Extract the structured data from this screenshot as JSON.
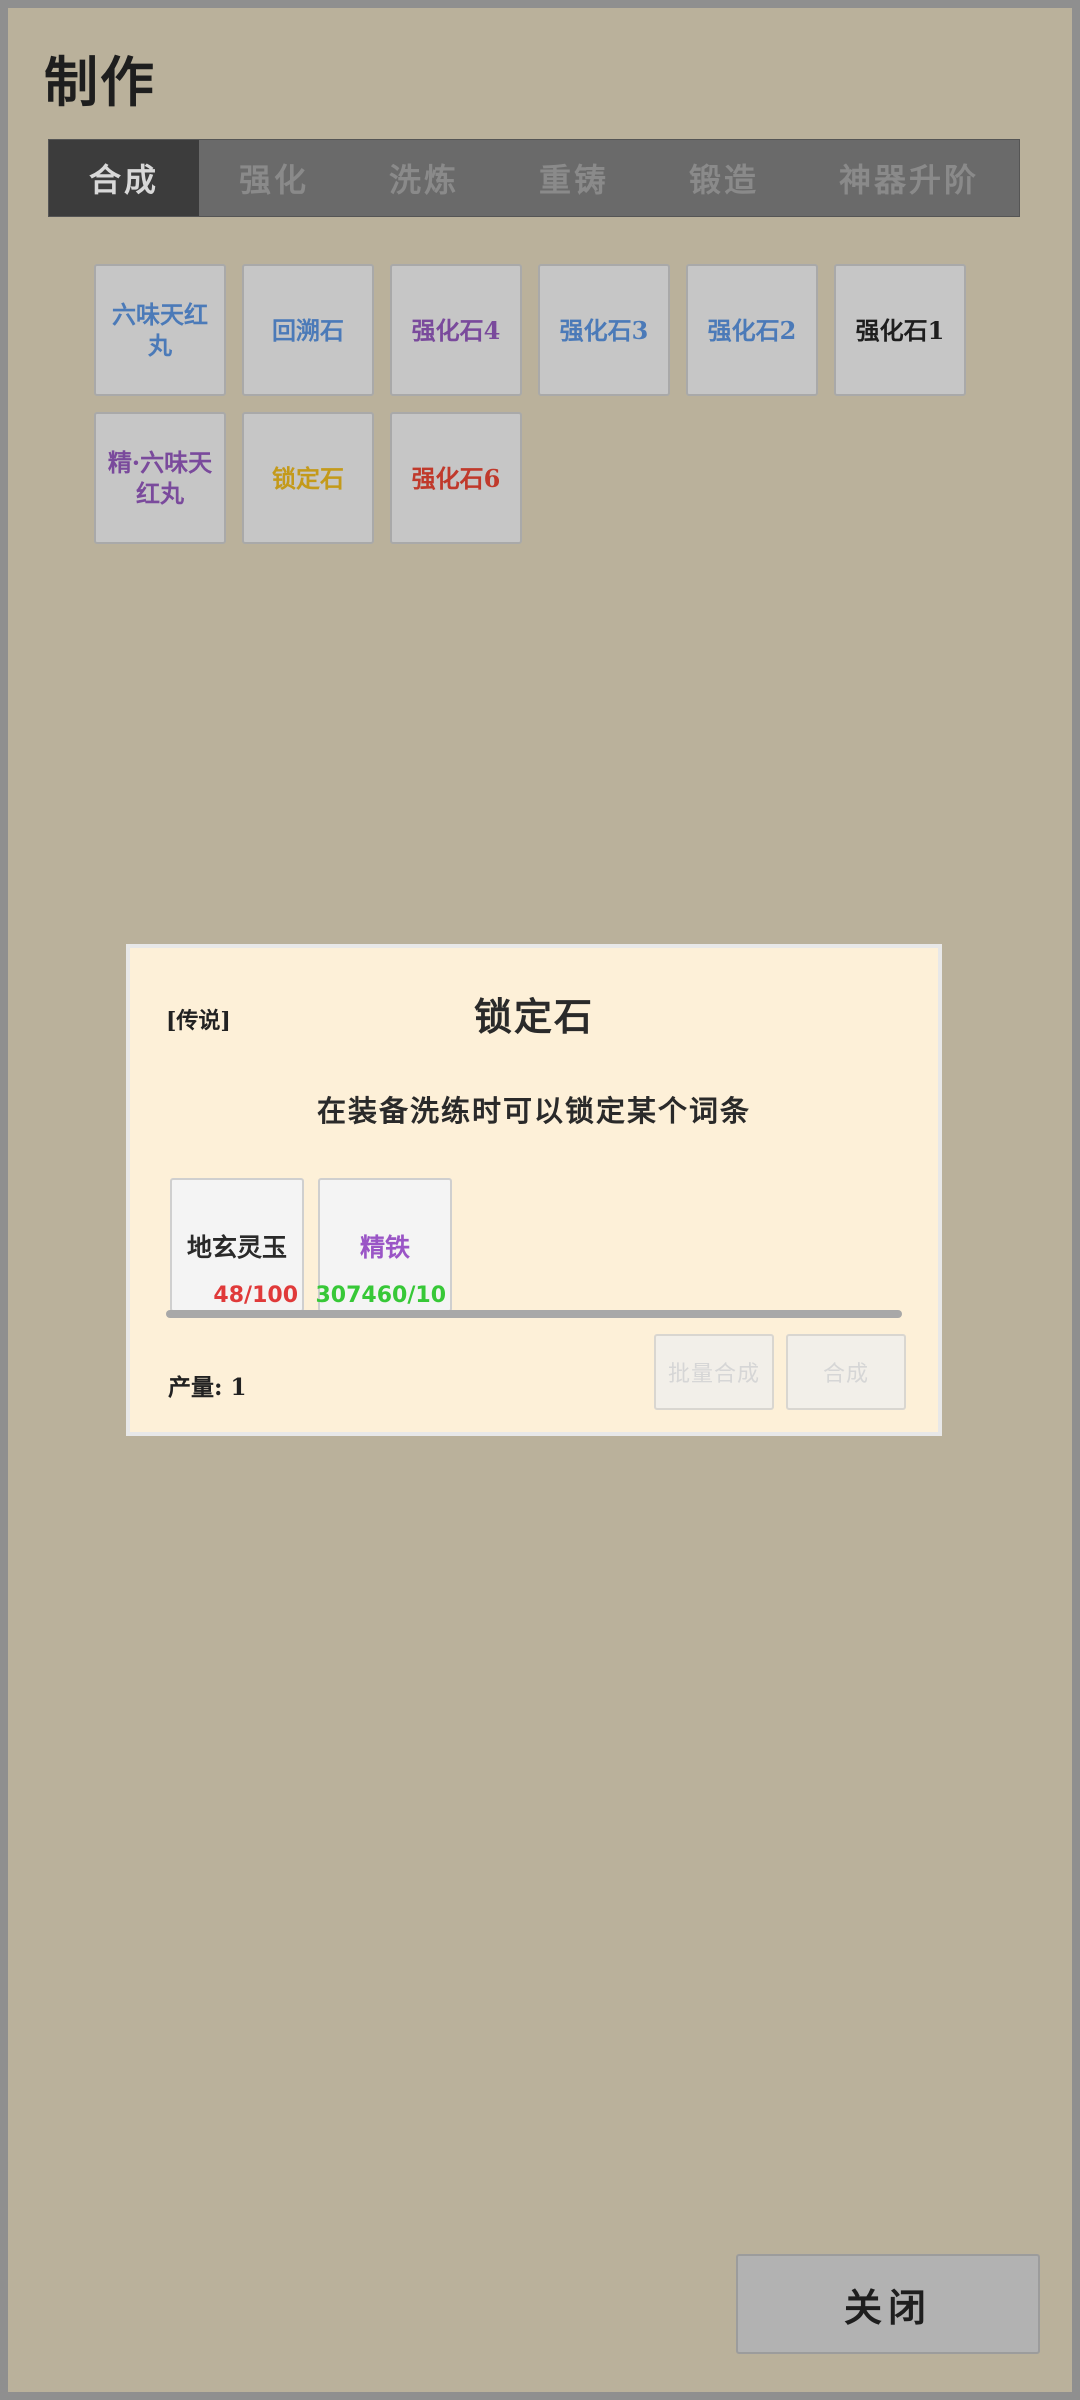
{
  "title": "制作",
  "tabs": [
    {
      "label": "合成",
      "active": true
    },
    {
      "label": "强化",
      "active": false
    },
    {
      "label": "洗炼",
      "active": false
    },
    {
      "label": "重铸",
      "active": false
    },
    {
      "label": "锻造",
      "active": false
    },
    {
      "label": "神器升阶",
      "active": false
    }
  ],
  "recipes": [
    {
      "name": "六味天红丸",
      "color": "#4b7ab8"
    },
    {
      "name": "回溯石",
      "color": "#4b7ab8"
    },
    {
      "name": "强化石4",
      "color": "#7a4a9c"
    },
    {
      "name": "强化石3",
      "color": "#4b7ab8"
    },
    {
      "name": "强化石2",
      "color": "#4b7ab8"
    },
    {
      "name": "强化石1",
      "color": "#1e1e1e"
    },
    {
      "name": "精·六味天红丸",
      "color": "#7a4a9c"
    },
    {
      "name": "锁定石",
      "color": "#c49a1a"
    },
    {
      "name": "强化石6",
      "color": "#c0392b"
    }
  ],
  "dialog": {
    "rarity": "[传说]",
    "item_name": "锁定石",
    "description": "在装备洗练时可以锁定某个词条",
    "materials": [
      {
        "name": "地玄灵玉",
        "name_color": "#2a2a2a",
        "count": "48/100",
        "count_color": "#e03a3a"
      },
      {
        "name": "精铁",
        "name_color": "#9a55c6",
        "count": "307460/10",
        "count_color": "#37c837"
      }
    ],
    "yield_label": "产量: 1",
    "batch_button": "批量合成",
    "craft_button": "合成"
  },
  "close_button": "关闭"
}
